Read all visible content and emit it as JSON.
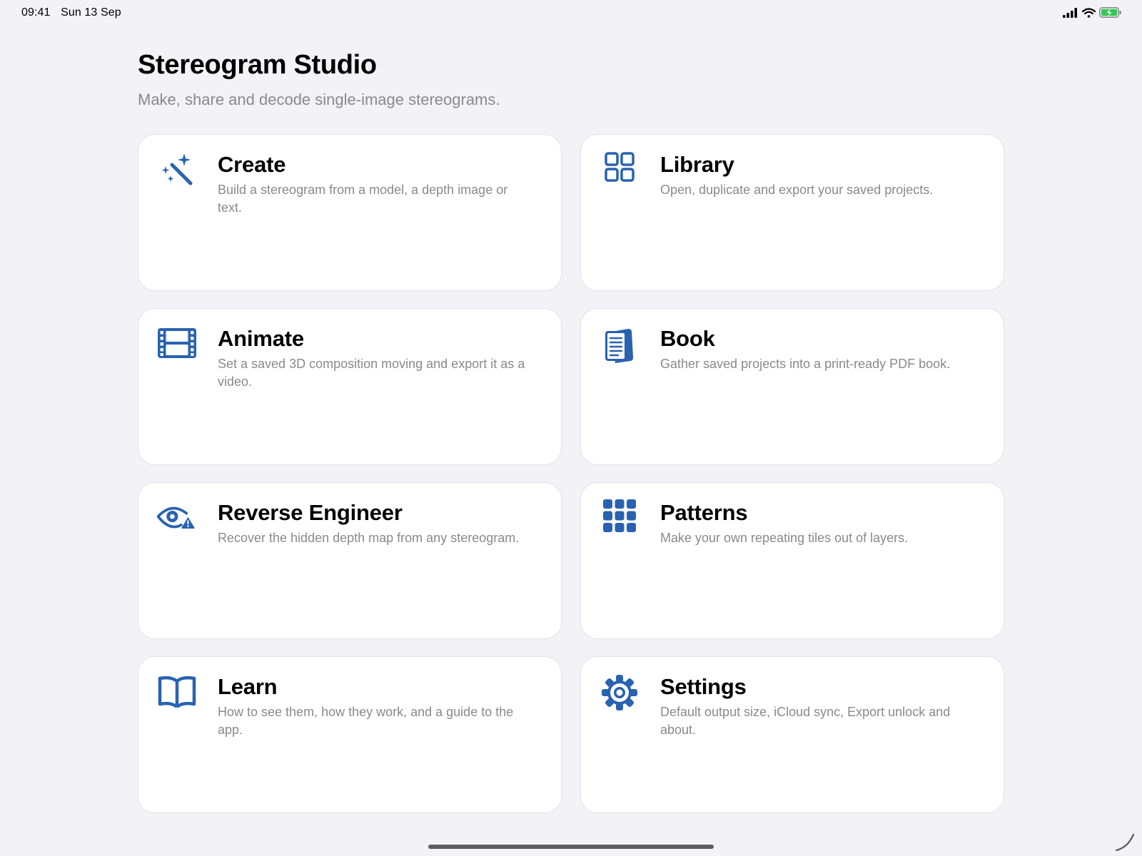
{
  "status_bar": {
    "time": "09:41",
    "date": "Sun 13 Sep",
    "signal_icon": "cellular-signal-icon",
    "wifi_icon": "wifi-icon",
    "battery_icon": "battery-charging-icon",
    "battery_color": "#34C759"
  },
  "header": {
    "title": "Stereogram Studio",
    "subtitle": "Make, share and decode single-image stereograms."
  },
  "theme": {
    "accent": "#2962B0",
    "background": "#F2F2F7",
    "card_background": "#FFFFFF",
    "secondary_text": "#8A8A8E"
  },
  "cards": [
    {
      "icon": "magic-wand-icon",
      "title": "Create",
      "description": "Build a stereogram from a model, a depth image or text."
    },
    {
      "icon": "grid-squares-icon",
      "title": "Library",
      "description": "Open, duplicate and export your saved projects."
    },
    {
      "icon": "film-icon",
      "title": "Animate",
      "description": "Set a saved 3D composition moving and export it as a video."
    },
    {
      "icon": "document-stack-icon",
      "title": "Book",
      "description": "Gather saved projects into a print-ready PDF book."
    },
    {
      "icon": "eye-warning-icon",
      "title": "Reverse Engineer",
      "description": "Recover the hidden depth map from any stereogram."
    },
    {
      "icon": "nine-dots-grid-icon",
      "title": "Patterns",
      "description": "Make your own repeating tiles out of layers."
    },
    {
      "icon": "open-book-icon",
      "title": "Learn",
      "description": "How to see them, how they work, and a guide to the app."
    },
    {
      "icon": "gear-icon",
      "title": "Settings",
      "description": "Default output size, iCloud sync, Export unlock and about."
    }
  ]
}
